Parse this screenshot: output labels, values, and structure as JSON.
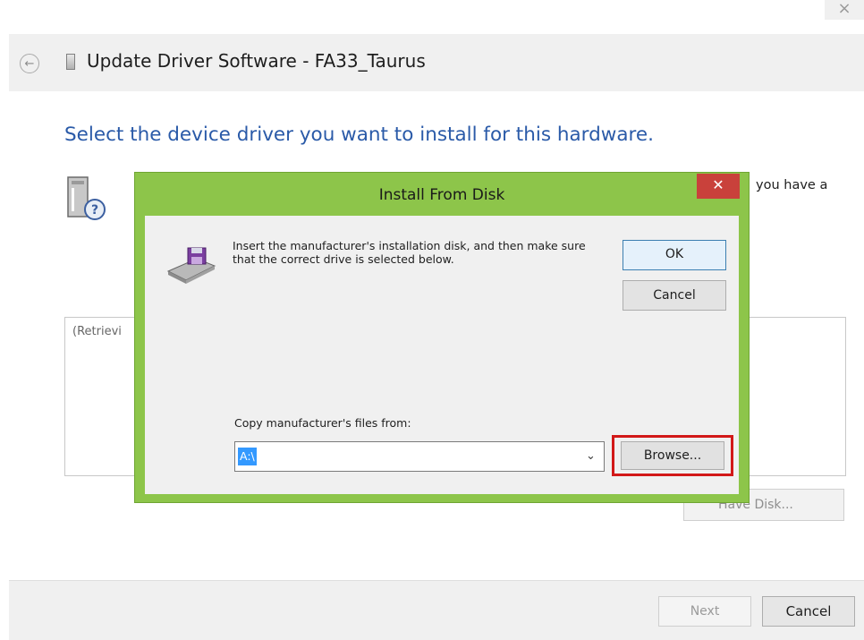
{
  "wizard": {
    "title": "Update Driver Software - FA33_Taurus",
    "heading": "Select the device driver you want to install for this hardware.",
    "partial_text": "you have a",
    "list_text": "(Retrievi",
    "have_disk_label": "Have Disk...",
    "next_label": "Next",
    "cancel_label": "Cancel",
    "outer_close_glyph": "×",
    "back_glyph": "←"
  },
  "dialog": {
    "title": "Install From Disk",
    "close_glyph": "✕",
    "instruction": "Insert the manufacturer's installation disk, and then make sure that the correct drive is selected below.",
    "ok_label": "OK",
    "cancel_label": "Cancel",
    "copy_label": "Copy manufacturer's files from:",
    "path_value": "A:\\",
    "dropdown_glyph": "⌄",
    "browse_label": "Browse...",
    "highlight_color": "#d21818",
    "accent_color": "#8dc54a",
    "close_color": "#c9413b"
  },
  "icons": [
    "back-arrow-icon",
    "device-icon",
    "device-help-icon",
    "floppy-disk-icon",
    "chevron-down-icon",
    "close-icon"
  ]
}
